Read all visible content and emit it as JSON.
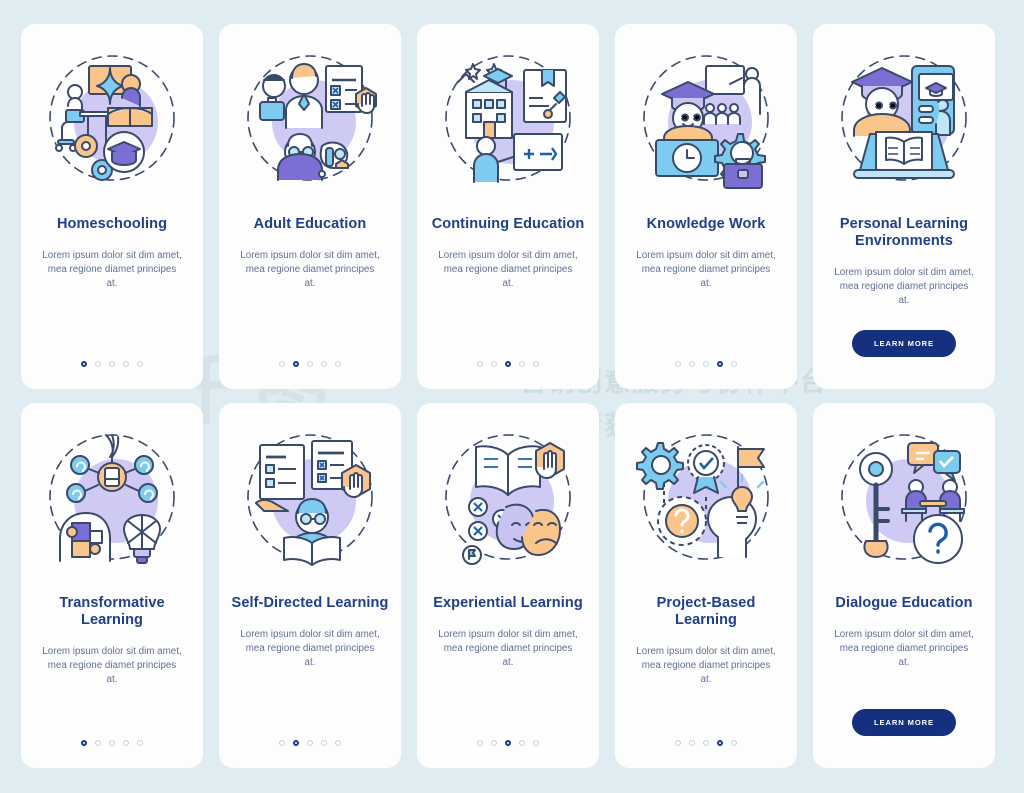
{
  "background_color": "#dfecf1",
  "card_color": "#fdfdfd",
  "title_color": "#1f3f86",
  "body_color": "#5f6f96",
  "accent_color": "#14307f",
  "dot_inactive_color": "#c7d3e4",
  "watermark": {
    "logo": "千图",
    "line1": "营销创意服务与协作平台",
    "line2": "商用请获取授权"
  },
  "cards": [
    {
      "title": "Homeschooling",
      "body": "Lorem ipsum dolor sit dim amet, mea regione diamet principes at.",
      "icon": "homeschooling-illustration",
      "dots": 5,
      "active_dot": 1,
      "cta": null
    },
    {
      "title": "Adult Education",
      "body": "Lorem ipsum dolor sit dim amet, mea regione diamet principes at.",
      "icon": "adult-education-illustration",
      "dots": 5,
      "active_dot": 2,
      "cta": null
    },
    {
      "title": "Continuing Education",
      "body": "Lorem ipsum dolor sit dim amet, mea regione diamet principes at.",
      "icon": "continuing-education-illustration",
      "dots": 5,
      "active_dot": 3,
      "cta": null
    },
    {
      "title": "Knowledge Work",
      "body": "Lorem ipsum dolor sit dim amet, mea regione diamet principes at.",
      "icon": "knowledge-work-illustration",
      "dots": 5,
      "active_dot": 4,
      "cta": null
    },
    {
      "title": "Personal Learning Environments",
      "body": "Lorem ipsum dolor sit dim amet, mea regione diamet principes at.",
      "icon": "personal-learning-environments-illustration",
      "dots": 5,
      "active_dot": 5,
      "cta": "LEARN MORE"
    },
    {
      "title": "Transformative Learning",
      "body": "Lorem ipsum dolor sit dim amet, mea regione diamet principes at.",
      "icon": "transformative-learning-illustration",
      "dots": 5,
      "active_dot": 1,
      "cta": null
    },
    {
      "title": "Self-Directed Learning",
      "body": "Lorem ipsum dolor sit dim amet, mea regione diamet principes at.",
      "icon": "self-directed-learning-illustration",
      "dots": 5,
      "active_dot": 2,
      "cta": null
    },
    {
      "title": "Experiential Learning",
      "body": "Lorem ipsum dolor sit dim amet, mea regione diamet principes at.",
      "icon": "experiential-learning-illustration",
      "dots": 5,
      "active_dot": 3,
      "cta": null
    },
    {
      "title": "Project-Based Learning",
      "body": "Lorem ipsum dolor sit dim amet, mea regione diamet principes at.",
      "icon": "project-based-learning-illustration",
      "dots": 5,
      "active_dot": 4,
      "cta": null
    },
    {
      "title": "Dialogue Education",
      "body": "Lorem ipsum dolor sit dim amet, mea regione diamet principes at.",
      "icon": "dialogue-education-illustration",
      "dots": 5,
      "active_dot": 5,
      "cta": "LEARN MORE"
    }
  ]
}
